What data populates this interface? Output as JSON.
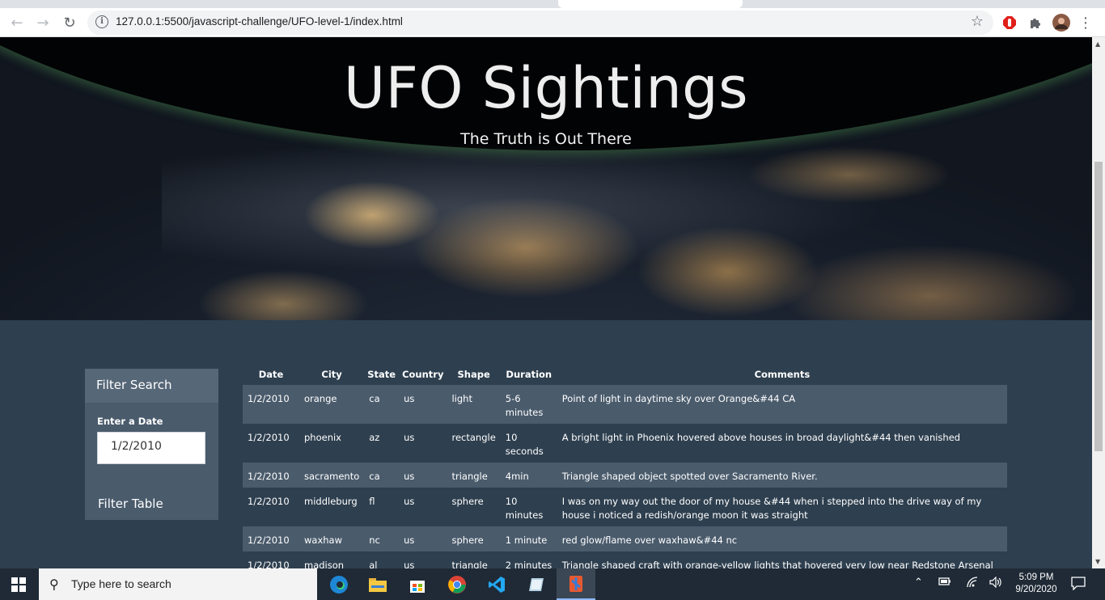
{
  "browser": {
    "url": "127.0.0.1:5500/javascript-challenge/UFO-level-1/index.html"
  },
  "hero": {
    "title": "UFO Sightings",
    "subtitle": "The Truth is Out There"
  },
  "filter": {
    "header": "Filter Search",
    "date_label": "Enter a Date",
    "date_value": "1/2/2010",
    "button_label": "Filter Table"
  },
  "table": {
    "headers": [
      "Date",
      "City",
      "State",
      "Country",
      "Shape",
      "Duration",
      "Comments"
    ],
    "rows": [
      [
        "1/2/2010",
        "orange",
        "ca",
        "us",
        "light",
        "5-6 minutes",
        "Point of light in daytime sky over Orange&#44 CA"
      ],
      [
        "1/2/2010",
        "phoenix",
        "az",
        "us",
        "rectangle",
        "10 seconds",
        "A bright light in Phoenix hovered above houses in broad daylight&#44 then vanished"
      ],
      [
        "1/2/2010",
        "sacramento",
        "ca",
        "us",
        "triangle",
        "4min",
        "Triangle shaped object spotted over Sacramento River."
      ],
      [
        "1/2/2010",
        "middleburg",
        "fl",
        "us",
        "sphere",
        "10 minutes",
        "I was on my way out the door of my house &#44 when i stepped into the drive way of my house i noticed a redish/orange moon it was straight"
      ],
      [
        "1/2/2010",
        "waxhaw",
        "nc",
        "us",
        "sphere",
        "1 minute",
        "red glow/flame over waxhaw&#44 nc"
      ],
      [
        "1/2/2010",
        "madison",
        "al",
        "us",
        "triangle",
        "2 minutes",
        "Triangle shaped craft with orange-yellow lights that hovered very low near Redstone Arsenal in"
      ]
    ]
  },
  "taskbar": {
    "search_placeholder": "Type here to search",
    "time": "5:09 PM",
    "date": "9/20/2020"
  }
}
